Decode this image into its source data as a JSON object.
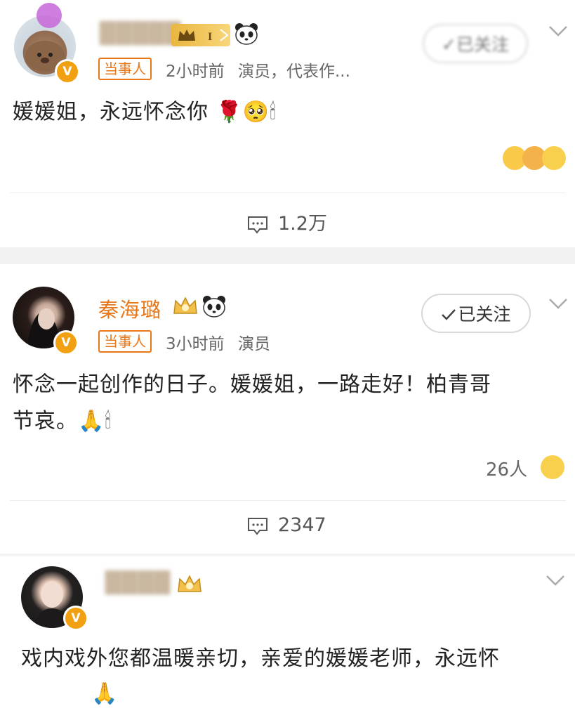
{
  "posts": [
    {
      "username": "█████",
      "role_tag": "当事人",
      "time": "2小时前",
      "bio": "演员，代表作...",
      "follow_label": "✓已关注",
      "text": "媛媛姐，永远怀念你 🌹🥺🕯",
      "comments": "1.2万"
    },
    {
      "username": "秦海璐",
      "role_tag": "当事人",
      "time": "3小时前",
      "bio": "演员",
      "follow_label": "已关注",
      "text_line1": "怀念一起创作的日子。媛媛姐，一路走好！柏青哥",
      "text_line2": "节哀。🙏🕯",
      "likes": "26人",
      "comments": "2347"
    },
    {
      "username": "████",
      "text": "戏内戏外您都温暖亲切，亲爱的媛媛老师，永远怀",
      "text_line2": "🙏"
    }
  ],
  "colors": {
    "accent": "#e8771a",
    "badge": "#f0a010",
    "separator": "#f2f2f2"
  },
  "icons": [
    "avatar-badge-v-icon",
    "crown-icon",
    "panda-icon",
    "chevron-down-icon",
    "comment-icon",
    "check-icon",
    "crying-face-icon"
  ]
}
